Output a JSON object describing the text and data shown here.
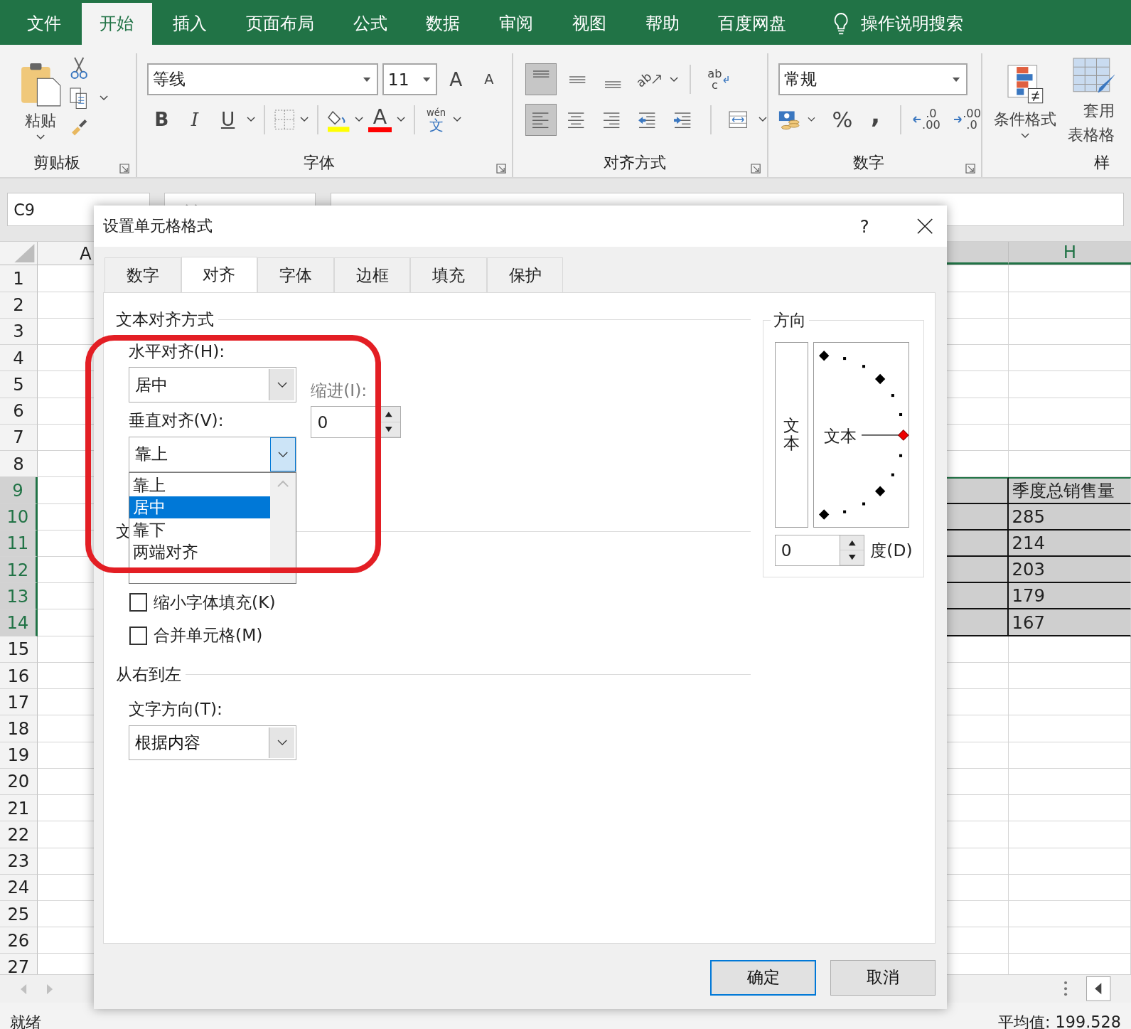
{
  "tabs": [
    {
      "label": "文件",
      "selected": false
    },
    {
      "label": "开始",
      "selected": true
    },
    {
      "label": "插入",
      "selected": false
    },
    {
      "label": "页面布局",
      "selected": false
    },
    {
      "label": "公式",
      "selected": false
    },
    {
      "label": "数据",
      "selected": false
    },
    {
      "label": "审阅",
      "selected": false
    },
    {
      "label": "视图",
      "selected": false
    },
    {
      "label": "帮助",
      "selected": false
    },
    {
      "label": "百度网盘",
      "selected": false
    }
  ],
  "tell_me": "操作说明搜索",
  "ribbon": {
    "clipboard": {
      "paste": "粘贴",
      "label": "剪贴板"
    },
    "font": {
      "name": "等线",
      "size": "11",
      "grow": "A",
      "shrink": "A",
      "bold": "B",
      "italic": "I",
      "underline": "U",
      "font_color": "A",
      "phonetic": "wén",
      "phonetic_char": "文",
      "label": "字体"
    },
    "alignment": {
      "label": "对齐方式",
      "rows": [
        [
          {
            "kind": "align-top",
            "pressed": true
          },
          {
            "kind": "align-middle",
            "pressed": false
          },
          {
            "kind": "align-bottom",
            "pressed": false
          },
          {
            "kind": "orientation",
            "text": "ab",
            "pressed": false
          },
          {
            "kind": "wrap",
            "text": "ab",
            "text2": "c",
            "pressed": false
          }
        ],
        [
          {
            "kind": "align-left",
            "pressed": true
          },
          {
            "kind": "align-center",
            "pressed": false
          },
          {
            "kind": "align-right",
            "pressed": false
          },
          {
            "kind": "indent-decrease",
            "pressed": false
          },
          {
            "kind": "indent-increase",
            "pressed": false
          },
          {
            "kind": "merge",
            "pressed": false
          }
        ]
      ]
    },
    "number": {
      "format": "常规",
      "percent": "%",
      "comma": ",",
      "increase_decimal": [
        ".0",
        ".00"
      ],
      "decrease_decimal": [
        ".00",
        ".0"
      ],
      "label": "数字"
    },
    "styles": {
      "conditional": "条件格式",
      "table": [
        "套用",
        "表格格"
      ],
      "label": "样"
    }
  },
  "formula_bar": {
    "name_box": "C9"
  },
  "sheet": {
    "columns": [
      {
        "label": "A",
        "selected": false
      },
      {
        "label": "H",
        "selected": true
      }
    ],
    "rows": [
      {
        "number": "1",
        "selected": false
      },
      {
        "number": "2",
        "selected": false
      },
      {
        "number": "3",
        "selected": false
      },
      {
        "number": "4",
        "selected": false
      },
      {
        "number": "5",
        "selected": false
      },
      {
        "number": "6",
        "selected": false
      },
      {
        "number": "7",
        "selected": false
      },
      {
        "number": "8",
        "selected": false
      },
      {
        "number": "9",
        "selected": true,
        "h": "季度总销售量"
      },
      {
        "number": "10",
        "selected": true,
        "h": "285"
      },
      {
        "number": "11",
        "selected": true,
        "h": "214"
      },
      {
        "number": "12",
        "selected": true,
        "h": "203"
      },
      {
        "number": "13",
        "selected": true,
        "h": "179"
      },
      {
        "number": "14",
        "selected": true,
        "h": "167"
      },
      {
        "number": "15",
        "selected": false
      },
      {
        "number": "16",
        "selected": false
      },
      {
        "number": "17",
        "selected": false
      },
      {
        "number": "18",
        "selected": false
      },
      {
        "number": "19",
        "selected": false
      },
      {
        "number": "20",
        "selected": false
      },
      {
        "number": "21",
        "selected": false
      },
      {
        "number": "22",
        "selected": false
      },
      {
        "number": "23",
        "selected": false
      },
      {
        "number": "24",
        "selected": false
      },
      {
        "number": "25",
        "selected": false
      },
      {
        "number": "26",
        "selected": false
      },
      {
        "number": "27",
        "selected": false
      }
    ]
  },
  "dialog": {
    "title": "设置单元格格式",
    "help": "?",
    "tabs": [
      {
        "label": "数字",
        "selected": false
      },
      {
        "label": "对齐",
        "selected": true
      },
      {
        "label": "字体",
        "selected": false
      },
      {
        "label": "边框",
        "selected": false
      },
      {
        "label": "填充",
        "selected": false
      },
      {
        "label": "保护",
        "selected": false
      }
    ],
    "text_alignment": {
      "title": "文本对齐方式",
      "horizontal_label": "水平对齐(H):",
      "horizontal_value": "居中",
      "indent_label": "缩进(I):",
      "indent_disabled": true,
      "indent_value": "0",
      "vertical_label": "垂直对齐(V):",
      "vertical_value": "靠上",
      "vertical_open": true,
      "vertical_options": [
        {
          "label": "靠上",
          "selected": false
        },
        {
          "label": "居中",
          "selected": true
        },
        {
          "label": "靠下",
          "selected": false
        },
        {
          "label": "两端对齐",
          "selected": false
        }
      ]
    },
    "text_control": {
      "title": "文",
      "options": [
        {
          "label": "缩小字体填充(K)",
          "checked": false
        },
        {
          "label": "合并单元格(M)",
          "checked": false
        }
      ]
    },
    "rtl": {
      "title": "从右到左",
      "direction_label": "文字方向(T):",
      "direction_value": "根据内容"
    },
    "orientation": {
      "title": "方向",
      "vertical_text": "文本",
      "sample_text": "文本",
      "degrees": "0",
      "degrees_label": "度(D)"
    },
    "buttons": [
      {
        "label": "确定",
        "default": true
      },
      {
        "label": "取消",
        "default": false
      }
    ]
  },
  "status_bar": {
    "ready": "就绪",
    "average": "平均值: 199.528"
  }
}
